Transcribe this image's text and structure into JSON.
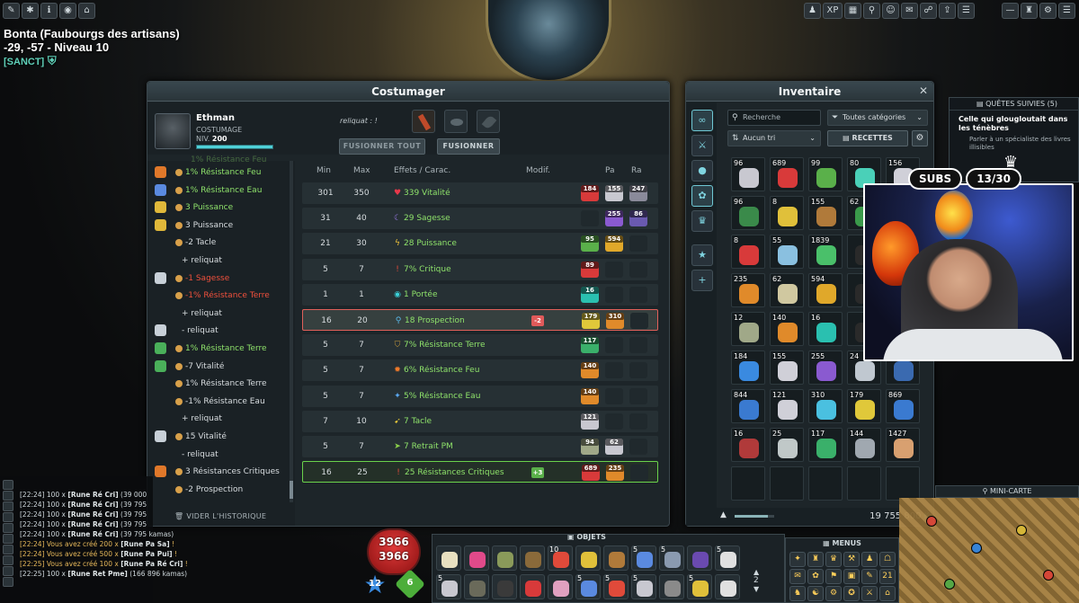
{
  "location": {
    "name": "Bonta (Faubourgs des artisans)",
    "coords_level": "-29, -57 - Niveau 10",
    "status": "[SANCT]"
  },
  "top_left_toolbar": [
    "pencil-icon",
    "settings-icon",
    "info-icon",
    "eye-icon",
    "shop-icon"
  ],
  "top_right_toolbar": [
    "character-icon",
    "XP",
    "map-icon",
    "location-icon",
    "smiley-icon",
    "chat-icon",
    "people-icon",
    "upload-icon",
    "list-icon"
  ],
  "top_right_controls": [
    "minimize-icon",
    "robot-icon",
    "gear-icon",
    "menu-icon"
  ],
  "costumager": {
    "title": "Costumager",
    "character": {
      "name": "Ethman",
      "job": "COSTUMAGE",
      "level_label": "NIV.",
      "level": "200",
      "xp_fill": 1.0
    },
    "reliquat_label": "reliquat : !",
    "fuse_all_button": "FUSIONNER TOUT",
    "fuse_button": "FUSIONNER",
    "history": [
      {
        "icon": "orange",
        "star": true,
        "text": "1% Résistance Feu",
        "cls": "pos"
      },
      {
        "icon": "blue",
        "star": true,
        "text": "1% Résistance Eau",
        "cls": "pos"
      },
      {
        "icon": "yellow",
        "star": true,
        "text": "3 Puissance",
        "cls": "pos"
      },
      {
        "icon": "yellow",
        "star": true,
        "text": "3 Puissance",
        "cls": "pl"
      },
      {
        "icon": "",
        "star": true,
        "text": "-2 Tacle",
        "cls": "pl"
      },
      {
        "icon": "",
        "star": false,
        "text": "+ reliquat",
        "cls": "pl"
      },
      {
        "icon": "white",
        "star": true,
        "text": "-1 Sagesse",
        "cls": "neg"
      },
      {
        "icon": "",
        "star": true,
        "text": "-1% Résistance Terre",
        "cls": "neg"
      },
      {
        "icon": "",
        "star": false,
        "text": "+ reliquat",
        "cls": "pl"
      },
      {
        "icon": "white",
        "star": false,
        "text": "- reliquat",
        "cls": "pl"
      },
      {
        "icon": "green",
        "star": true,
        "text": "1% Résistance Terre",
        "cls": "pos"
      },
      {
        "icon": "green",
        "star": true,
        "text": "-7 Vitalité",
        "cls": "pl"
      },
      {
        "icon": "",
        "star": true,
        "text": "1% Résistance Terre",
        "cls": "pl"
      },
      {
        "icon": "",
        "star": true,
        "text": "-1% Résistance Eau",
        "cls": "pl"
      },
      {
        "icon": "",
        "star": false,
        "text": "+ reliquat",
        "cls": "pl"
      },
      {
        "icon": "white",
        "star": true,
        "text": "15 Vitalité",
        "cls": "pl"
      },
      {
        "icon": "",
        "star": false,
        "text": "- reliquat",
        "cls": "pl"
      },
      {
        "icon": "orange",
        "star": true,
        "text": "3 Résistances Critiques",
        "cls": "pl"
      },
      {
        "icon": "",
        "star": true,
        "text": "-2 Prospection",
        "cls": "pl"
      }
    ],
    "history_partial_top": "1% Résistance Feu",
    "clear_history": "VIDER L'HISTORIQUE",
    "columns": {
      "min": "Min",
      "max": "Max",
      "effects": "Effets / Carac.",
      "modif": "Modif.",
      "pa": "Pa",
      "ra": "Ra"
    },
    "rows": [
      {
        "min": "301",
        "max": "350",
        "glyph": "♥",
        "gcolor": "#e8384a",
        "effect": "339 Vitalité",
        "pa": "184",
        "ra1": "155",
        "ra2": "247",
        "modif": "",
        "state": ""
      },
      {
        "min": "31",
        "max": "40",
        "glyph": "☾",
        "gcolor": "#9a7be8",
        "effect": "29 Sagesse",
        "pa": "",
        "ra1": "255",
        "ra2": "86",
        "modif": "",
        "state": ""
      },
      {
        "min": "21",
        "max": "30",
        "glyph": "ϟ",
        "gcolor": "#f0c43a",
        "effect": "28 Puissance",
        "pa": "95",
        "ra1": "594",
        "ra2": "",
        "modif": "",
        "state": ""
      },
      {
        "min": "5",
        "max": "7",
        "glyph": "!",
        "gcolor": "#e04a3a",
        "effect": "7% Critique",
        "pa": "89",
        "ra1": "",
        "ra2": "",
        "modif": "",
        "state": ""
      },
      {
        "min": "1",
        "max": "1",
        "glyph": "◉",
        "gcolor": "#3ad0d8",
        "effect": "1 Portée",
        "pa": "16",
        "ra1": "",
        "ra2": "",
        "modif": "",
        "state": ""
      },
      {
        "min": "16",
        "max": "20",
        "glyph": "⚲",
        "gcolor": "#5ab8e8",
        "effect": "18 Prospection",
        "pa": "179",
        "ra1": "310",
        "ra2": "",
        "modif": "-2",
        "state": "sel"
      },
      {
        "min": "5",
        "max": "7",
        "glyph": "⛉",
        "gcolor": "#c89a3a",
        "effect": "7% Résistance Terre",
        "pa": "117",
        "ra1": "",
        "ra2": "",
        "modif": "",
        "state": ""
      },
      {
        "min": "5",
        "max": "7",
        "glyph": "✹",
        "gcolor": "#f07a2a",
        "effect": "6% Résistance Feu",
        "pa": "140",
        "ra1": "",
        "ra2": "",
        "modif": "",
        "state": ""
      },
      {
        "min": "5",
        "max": "7",
        "glyph": "✦",
        "gcolor": "#5aa8f0",
        "effect": "5% Résistance Eau",
        "pa": "140",
        "ra1": "",
        "ra2": "",
        "modif": "",
        "state": ""
      },
      {
        "min": "7",
        "max": "10",
        "glyph": "➹",
        "gcolor": "#e0c43a",
        "effect": "7 Tacle",
        "pa": "121",
        "ra1": "",
        "ra2": "",
        "modif": "",
        "state": ""
      },
      {
        "min": "5",
        "max": "7",
        "glyph": "➤",
        "gcolor": "#8ad04a",
        "effect": "7 Retrait PM",
        "pa": "94",
        "ra1": "62",
        "ra2": "",
        "modif": "",
        "state": ""
      },
      {
        "min": "16",
        "max": "25",
        "glyph": "!",
        "gcolor": "#e04a3a",
        "effect": "25 Résistances Critiques",
        "pa": "689",
        "ra1": "235",
        "ra2": "",
        "modif": "+3",
        "state": "hl"
      }
    ]
  },
  "inventory": {
    "title": "Inventaire",
    "search_placeholder": "Recherche",
    "category": "Toutes catégories",
    "sort": "Aucun tri",
    "recipes_button": "RECETTES",
    "kamas": "19 755 800",
    "weight_fill": 0.85,
    "items": [
      {
        "q": "96",
        "c": "#c8c8d0"
      },
      {
        "q": "689",
        "c": "#d83a3a"
      },
      {
        "q": "99",
        "c": "#5ab04a"
      },
      {
        "q": "80",
        "c": "#4ad0b8"
      },
      {
        "q": "156",
        "c": "#d0d0d8"
      },
      {
        "q": "96",
        "c": "#3a8a4a"
      },
      {
        "q": "8",
        "c": "#e0c03a"
      },
      {
        "q": "155",
        "c": "#b07a3a"
      },
      {
        "q": "62",
        "c": "#3a9a4a"
      },
      {
        "q": "",
        "c": "#2a2a2a"
      },
      {
        "q": "8",
        "c": "#d83a3a"
      },
      {
        "q": "55",
        "c": "#8ac0e0"
      },
      {
        "q": "1839",
        "c": "#4ac06a"
      },
      {
        "q": "",
        "c": "#2a2a2a"
      },
      {
        "q": "",
        "c": "#2a2a2a"
      },
      {
        "q": "235",
        "c": "#e08a2a"
      },
      {
        "q": "62",
        "c": "#d0c8a0"
      },
      {
        "q": "594",
        "c": "#e0a82a"
      },
      {
        "q": "",
        "c": "#2a2a2a"
      },
      {
        "q": "",
        "c": "#2a2a2a"
      },
      {
        "q": "12",
        "c": "#a0a888"
      },
      {
        "q": "140",
        "c": "#e08a2a"
      },
      {
        "q": "16",
        "c": "#2ac0b0"
      },
      {
        "q": "",
        "c": "#2a2a2a"
      },
      {
        "q": "",
        "c": "#2a2a2a"
      },
      {
        "q": "184",
        "c": "#3a8ae0"
      },
      {
        "q": "155",
        "c": "#d0d0d8"
      },
      {
        "q": "255",
        "c": "#8a5ad0"
      },
      {
        "q": "24",
        "c": "#c0c8d0"
      },
      {
        "q": "",
        "c": "#3a6ab0"
      },
      {
        "q": "844",
        "c": "#3a7ad0"
      },
      {
        "q": "121",
        "c": "#d0d0d8"
      },
      {
        "q": "310",
        "c": "#4ac0e0"
      },
      {
        "q": "179",
        "c": "#e0c83a"
      },
      {
        "q": "869",
        "c": "#3a7ad0"
      },
      {
        "q": "16",
        "c": "#b03a3a"
      },
      {
        "q": "25",
        "c": "#c0c8c8"
      },
      {
        "q": "117",
        "c": "#3ab06a"
      },
      {
        "q": "144",
        "c": "#a0a8b0"
      },
      {
        "q": "1427",
        "c": "#d8a070"
      },
      {
        "q": "",
        "c": ""
      },
      {
        "q": "",
        "c": ""
      },
      {
        "q": "",
        "c": ""
      },
      {
        "q": "",
        "c": ""
      },
      {
        "q": "",
        "c": ""
      }
    ]
  },
  "quests": {
    "header": "QUÊTES SUIVIES (5)",
    "title": "Celle qui glougloutait dans les ténèbres",
    "desc": "Parler à un spécialiste des livres illisibles",
    "partial": "Terre"
  },
  "stream": {
    "subs_label": "SUBS",
    "subs_count": "13/30"
  },
  "minimap": {
    "header": "MINI-CARTE"
  },
  "chat": [
    {
      "time": "[22:24]",
      "text": "100 x ",
      "rune": "[Rune Ré Cri]",
      "rest": " (39 000",
      "gold": false
    },
    {
      "time": "[22:24]",
      "text": "100 x ",
      "rune": "[Rune Ré Cri]",
      "rest": " (39 795",
      "gold": false
    },
    {
      "time": "[22:24]",
      "text": "100 x ",
      "rune": "[Rune Ré Cri]",
      "rest": " (39 795",
      "gold": false
    },
    {
      "time": "[22:24]",
      "text": "100 x ",
      "rune": "[Rune Ré Cri]",
      "rest": " (39 795",
      "gold": false
    },
    {
      "time": "[22:24]",
      "text": "100 x ",
      "rune": "[Rune Ré Cri]",
      "rest": " (39 795 kamas)",
      "gold": false
    },
    {
      "time": "[22:24]",
      "text": "Vous avez créé 200 x ",
      "rune": "[Rune Pa Sa]",
      "rest": " !",
      "gold": true
    },
    {
      "time": "[22:24]",
      "text": "Vous avez créé 500 x ",
      "rune": "[Rune Pa Pui]",
      "rest": " !",
      "gold": true
    },
    {
      "time": "[22:25]",
      "text": "Vous avez créé 100 x ",
      "rune": "[Rune Pa Ré Cri]",
      "rest": " !",
      "gold": true
    },
    {
      "time": "[22:25]",
      "text": "100 x ",
      "rune": "[Rune Ret Pme]",
      "rest": " (166 896 kamas)",
      "gold": false
    }
  ],
  "hud": {
    "hp_current": "3966",
    "hp_max": "3966",
    "ap": "12",
    "mp": "6",
    "hotbar_tab": "OBJETS",
    "menus": "MENUS",
    "page": "2"
  },
  "hotbar": [
    {
      "q": "",
      "c": "#e8e0c0"
    },
    {
      "q": "",
      "c": "#e04a8a"
    },
    {
      "q": "",
      "c": "#8a9a5a"
    },
    {
      "q": "",
      "c": "#8a6a3a"
    },
    {
      "q": "10",
      "c": "#e04a3a"
    },
    {
      "q": "",
      "c": "#e0c03a"
    },
    {
      "q": "",
      "c": "#b07a3a"
    },
    {
      "q": "5",
      "c": "#5a8ae0"
    },
    {
      "q": "5",
      "c": "#8a9ab0"
    },
    {
      "q": "",
      "c": "#6a4ab0"
    },
    {
      "q": "5",
      "c": "#e0e0e0"
    },
    {
      "q": "5",
      "c": "#c8c8d0"
    },
    {
      "q": "",
      "c": "#6a6a5a"
    },
    {
      "q": "",
      "c": "#3a3a3a"
    },
    {
      "q": "",
      "c": "#d83a3a"
    },
    {
      "q": "",
      "c": "#e0a0c0"
    },
    {
      "q": "5",
      "c": "#5a8ae0"
    },
    {
      "q": "5",
      "c": "#e04a3a"
    },
    {
      "q": "5",
      "c": "#c8c8d0"
    },
    {
      "q": "",
      "c": "#8a8a8a"
    },
    {
      "q": "5",
      "c": "#e0c03a"
    },
    {
      "q": "",
      "c": "#e0e0e0"
    }
  ],
  "menu_icons": [
    "✦",
    "♜",
    "♛",
    "⚒",
    "♟",
    "☖",
    "✉",
    "✿",
    "⚑",
    "▣",
    "✎",
    "21",
    "♞",
    "☯",
    "⚙",
    "✪",
    "⚔",
    "⌂"
  ]
}
